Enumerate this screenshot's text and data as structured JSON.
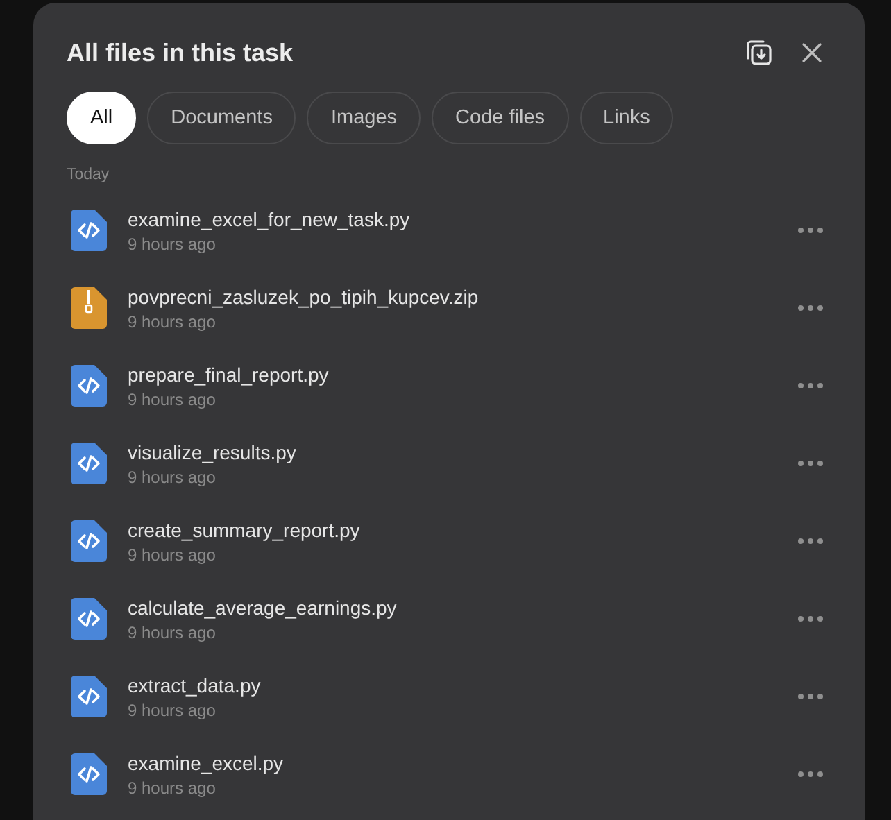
{
  "dialog": {
    "title": "All files in this task"
  },
  "tabs": [
    {
      "label": "All",
      "selected": true
    },
    {
      "label": "Documents",
      "selected": false
    },
    {
      "label": "Images",
      "selected": false
    },
    {
      "label": "Code files",
      "selected": false
    },
    {
      "label": "Links",
      "selected": false
    }
  ],
  "section": "Today",
  "files": [
    {
      "name": "examine_excel_for_new_task.py",
      "time": "9 hours ago",
      "kind": "code"
    },
    {
      "name": "povprecni_zasluzek_po_tipih_kupcev.zip",
      "time": "9 hours ago",
      "kind": "archive"
    },
    {
      "name": "prepare_final_report.py",
      "time": "9 hours ago",
      "kind": "code"
    },
    {
      "name": "visualize_results.py",
      "time": "9 hours ago",
      "kind": "code"
    },
    {
      "name": "create_summary_report.py",
      "time": "9 hours ago",
      "kind": "code"
    },
    {
      "name": "calculate_average_earnings.py",
      "time": "9 hours ago",
      "kind": "code"
    },
    {
      "name": "extract_data.py",
      "time": "9 hours ago",
      "kind": "code"
    },
    {
      "name": "examine_excel.py",
      "time": "9 hours ago",
      "kind": "code"
    }
  ]
}
